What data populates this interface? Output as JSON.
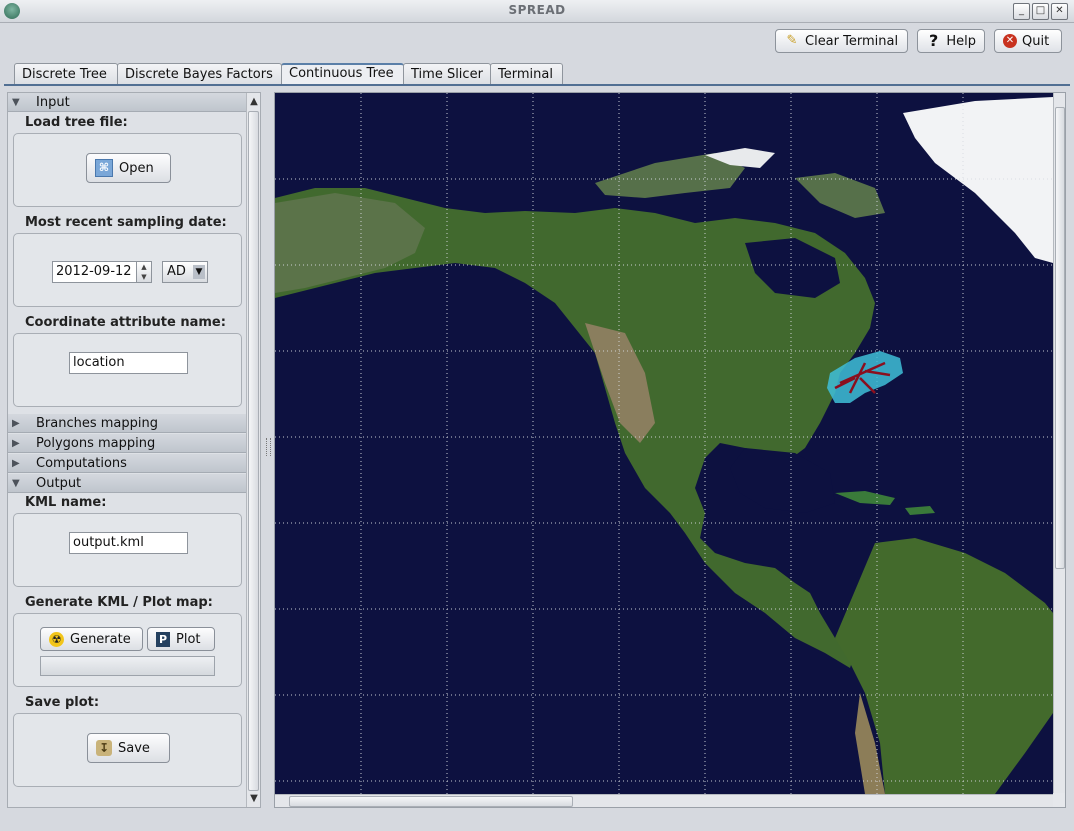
{
  "window": {
    "title": "SPREAD"
  },
  "toolbar": {
    "clear_terminal": "Clear Terminal",
    "help": "Help",
    "quit": "Quit"
  },
  "tabs": [
    {
      "label": "Discrete Tree"
    },
    {
      "label": "Discrete Bayes Factors"
    },
    {
      "label": "Continuous Tree",
      "active": true
    },
    {
      "label": "Time Slicer"
    },
    {
      "label": "Terminal"
    }
  ],
  "panel": {
    "input_header": "Input",
    "load_tree_label": "Load tree file:",
    "open_button": "Open",
    "sampling_date_label": "Most recent sampling date:",
    "date_value": "2012-09-12",
    "era_value": "AD",
    "coord_attr_label": "Coordinate attribute name:",
    "coord_attr_value": "location",
    "branches_header": "Branches mapping",
    "polygons_header": "Polygons mapping",
    "computations_header": "Computations",
    "output_header": "Output",
    "kml_name_label": "KML name:",
    "kml_name_value": "output.kml",
    "generate_label": "Generate KML / Plot map:",
    "generate_button": "Generate",
    "plot_button": "Plot",
    "progress": 0,
    "save_plot_label": "Save plot:",
    "save_button": "Save"
  },
  "map": {
    "ocean_color": "#0d1140",
    "land_color": "#3f6b2c",
    "polygon_color": "#3fc0d8",
    "branch_color": "#8b0f1e"
  }
}
